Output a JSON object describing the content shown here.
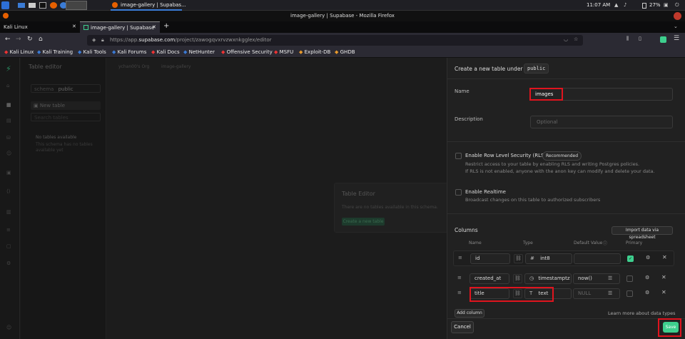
{
  "taskbar": {
    "active_window": "image-gallery | Supabas...",
    "time": "11:07 AM",
    "battery": "27%"
  },
  "window_title": "image-gallery | Supabase - Mozilla Firefox",
  "tabs": [
    {
      "label": "Kali Linux"
    },
    {
      "label": "image-gallery | Supabase"
    }
  ],
  "url": {
    "prefix": "https://app.",
    "domain": "supabase.com",
    "path": "/project/zawogqvxrvzwxnkgglex/editor"
  },
  "bookmarks": [
    "Kali Linux",
    "Kali Training",
    "Kali Tools",
    "Kali Forums",
    "Kali Docs",
    "NetHunter",
    "Offensive Security",
    "MSFU",
    "Exploit-DB",
    "GHDB"
  ],
  "editor": {
    "title": "Table editor",
    "org": "ychan00's Org",
    "project": "image-gallery",
    "schema_label": "schema",
    "schema_value": "public",
    "new_table": "New table",
    "search_placeholder": "Search tables",
    "no_tables_title": "No tables available",
    "no_tables_text": "This schema has no tables available yet",
    "card_title": "Table Editor",
    "card_text": "There are no tables available in this schema.",
    "card_button": "Create a new table"
  },
  "panel": {
    "header": "Create a new table under",
    "schema": "public",
    "name_label": "Name",
    "name_value": "images",
    "description_label": "Description",
    "description_placeholder": "Optional",
    "rls_label": "Enable Row Level Security (RLS)",
    "rls_badge": "Recommended",
    "rls_desc1": "Restrict access to your table by enabling RLS and writing Postgres policies.",
    "rls_desc2": "If RLS is not enabled, anyone with the anon key can modify and delete your data.",
    "realtime_label": "Enable Realtime",
    "realtime_desc": "Broadcast changes on this table to authorized subscribers",
    "columns_title": "Columns",
    "import_button": "Import data via spreadsheet",
    "col_headers": {
      "name": "Name",
      "type": "Type",
      "default": "Default Value",
      "primary": "Primary"
    },
    "columns": [
      {
        "name": "id",
        "type_icon": "#",
        "type": "int8",
        "default": "",
        "primary": true
      },
      {
        "name": "created_at",
        "type_icon": "◷",
        "type": "timestamptz",
        "default": "now()",
        "primary": false
      },
      {
        "name": "title",
        "type_icon": "T",
        "type": "text",
        "default": "NULL",
        "primary": false
      }
    ],
    "add_column": "Add column",
    "learn_more": "Learn more about data types",
    "cancel": "Cancel",
    "save": "Save"
  }
}
